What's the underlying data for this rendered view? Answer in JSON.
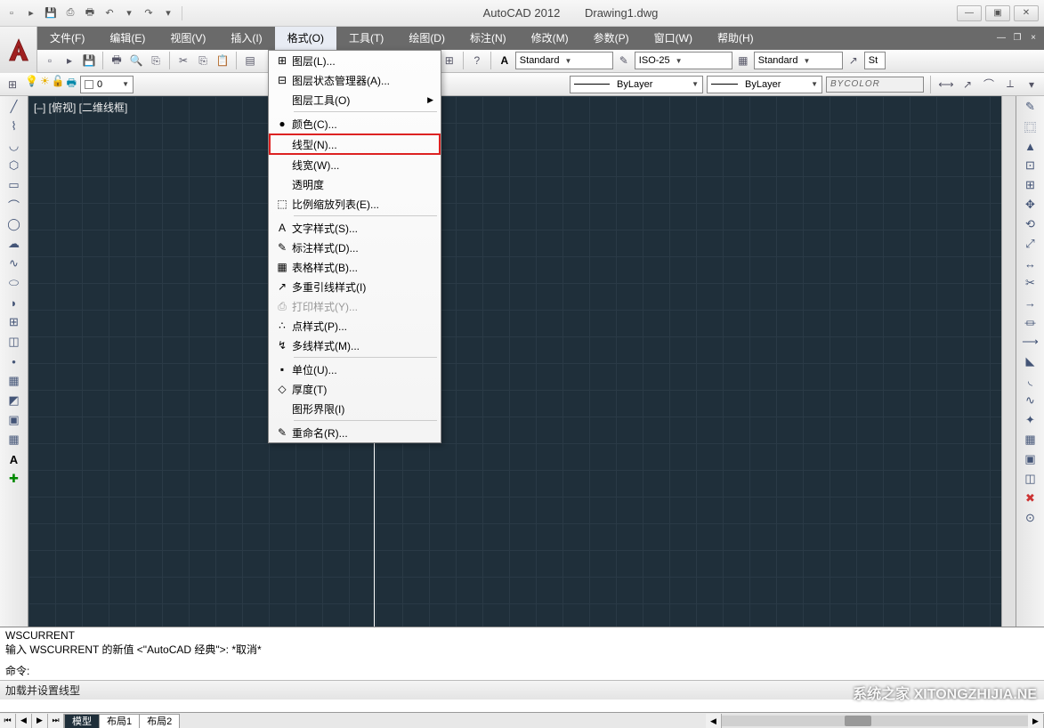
{
  "title": {
    "app": "AutoCAD 2012",
    "doc": "Drawing1.dwg"
  },
  "winctl": {
    "min": "—",
    "max": "▣",
    "close": "✕"
  },
  "menubar": {
    "items": [
      {
        "label": "文件(F)"
      },
      {
        "label": "编辑(E)"
      },
      {
        "label": "视图(V)"
      },
      {
        "label": "插入(I)"
      },
      {
        "label": "格式(O)"
      },
      {
        "label": "工具(T)"
      },
      {
        "label": "绘图(D)"
      },
      {
        "label": "标注(N)"
      },
      {
        "label": "修改(M)"
      },
      {
        "label": "参数(P)"
      },
      {
        "label": "窗口(W)"
      },
      {
        "label": "帮助(H)"
      }
    ],
    "right": {
      "min": "—",
      "restore": "❐",
      "close": "×"
    }
  },
  "styles": {
    "text": "Standard",
    "dim": "ISO-25",
    "table": "Standard",
    "extra": "St"
  },
  "layerbar": {
    "layer": "0",
    "linetype": "ByLayer",
    "lineweight": "ByLayer",
    "color": "BYCOLOR"
  },
  "dropdown": {
    "items": [
      {
        "icon": "⊞",
        "label": "图层(L)..."
      },
      {
        "icon": "⊟",
        "label": "图层状态管理器(A)..."
      },
      {
        "icon": "",
        "label": "图层工具(O)",
        "sub": true
      },
      {
        "sep": true
      },
      {
        "icon": "●",
        "label": "颜色(C)..."
      },
      {
        "icon": "",
        "label": "线型(N)...",
        "hl": true
      },
      {
        "icon": "",
        "label": "线宽(W)..."
      },
      {
        "icon": "",
        "label": "透明度"
      },
      {
        "icon": "⬚",
        "label": "比例缩放列表(E)..."
      },
      {
        "sep": true
      },
      {
        "icon": "A",
        "label": "文字样式(S)..."
      },
      {
        "icon": "✎",
        "label": "标注样式(D)..."
      },
      {
        "icon": "▦",
        "label": "表格样式(B)..."
      },
      {
        "icon": "↗",
        "label": "多重引线样式(I)"
      },
      {
        "icon": "⎙",
        "label": "打印样式(Y)...",
        "disabled": true
      },
      {
        "icon": "∴",
        "label": "点样式(P)..."
      },
      {
        "icon": "↯",
        "label": "多线样式(M)..."
      },
      {
        "sep": true
      },
      {
        "icon": "▪",
        "label": "单位(U)..."
      },
      {
        "icon": "◇",
        "label": "厚度(T)"
      },
      {
        "icon": "",
        "label": "图形界限(I)"
      },
      {
        "sep": true
      },
      {
        "icon": "✎",
        "label": "重命名(R)..."
      }
    ]
  },
  "canvas": {
    "label": "[–] [俯视] [二维线框]"
  },
  "tabs": {
    "t1": "模型",
    "t2": "布局1",
    "t3": "布局2"
  },
  "cmd": {
    "l1": "WSCURRENT",
    "l2": "输入 WSCURRENT 的新值 <\"AutoCAD 经典\">: *取消*",
    "l3": "命令:"
  },
  "status": "加载并设置线型",
  "watermark": "系统之家 XITONGZHIJIA.NE"
}
